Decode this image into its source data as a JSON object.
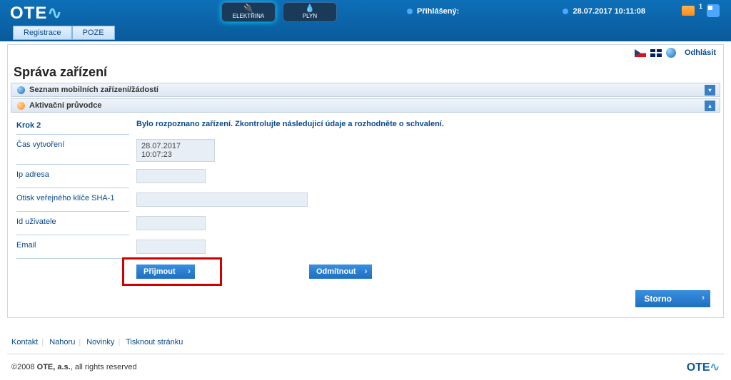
{
  "header": {
    "logo_text": "OTE",
    "sections": {
      "electricity": "ELEKTŘINA",
      "gas": "PLYN"
    },
    "login_label": "Přihlášený:",
    "datetime": "28.07.2017 10:11:08",
    "mail_count": "1",
    "nav": {
      "registrace": "Registrace",
      "poze": "POZE"
    }
  },
  "utilbar": {
    "logout": "Odhlásit"
  },
  "page": {
    "title": "Správa zařízení"
  },
  "accordion": {
    "list_header": "Seznam mobilních zařízení/žádostí",
    "wizard_header": "Aktivační průvodce"
  },
  "wizard": {
    "step_label": "Krok 2",
    "info": "Bylo rozpoznano zařízení. Zkontrolujte následujicí údaje a rozhodněte o schvalení.",
    "rows": {
      "created_label": "Čas vytvoření",
      "created_value": "28.07.2017 10:07:23",
      "ip_label": "Ip adresa",
      "ip_value": "",
      "fingerprint_label": "Otisk veřejného klíče SHA-1",
      "fingerprint_value": "",
      "userid_label": "Id uživatele",
      "userid_value": "",
      "email_label": "Email",
      "email_value": ""
    },
    "buttons": {
      "accept": "Přijmout",
      "reject": "Odmítnout",
      "cancel": "Storno"
    }
  },
  "footer": {
    "links": {
      "kontakt": "Kontakt",
      "nahoru": "Nahoru",
      "novinky": "Novinky",
      "tisknout": "Tisknout stránku"
    },
    "copyright_prefix": "©2008 ",
    "copyright_company": "OTE, a.s.",
    "copyright_suffix": ", all rights reserved",
    "logo_text": "OTE"
  }
}
